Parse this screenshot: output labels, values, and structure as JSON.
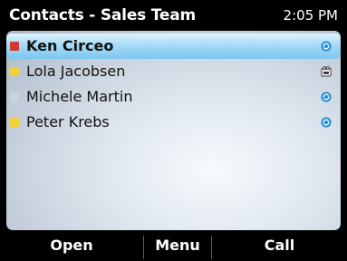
{
  "header": {
    "title": "Contacts - Sales Team",
    "time": "2:05 PM"
  },
  "contacts": [
    {
      "name": "Ken Circeo",
      "flag_color": "#d43a2f",
      "status_icon": "sync-icon",
      "selected": true
    },
    {
      "name": "Lola Jacobsen",
      "flag_color": "#f2d03a",
      "status_icon": "phone-book-icon",
      "selected": false
    },
    {
      "name": "Michele Martin",
      "flag_color": "#c9d3dc",
      "status_icon": "sync-icon",
      "selected": false
    },
    {
      "name": "Peter Krebs",
      "flag_color": "#f2d03a",
      "status_icon": "sync-icon",
      "selected": false
    }
  ],
  "softkeys": {
    "left": "Open",
    "center": "Menu",
    "right": "Call"
  },
  "colors": {
    "selection": "#7cc6ef",
    "status_blue": "#2a8fd6"
  }
}
